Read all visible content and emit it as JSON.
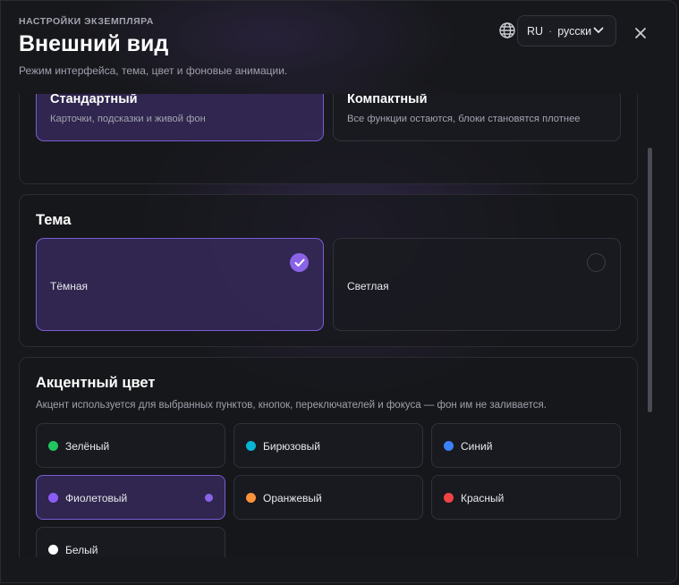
{
  "header": {
    "eyebrow": "НАСТРОЙКИ ЭКЗЕМПЛЯРА",
    "title": "Внешний вид",
    "subtitle": "Режим интерфейса, тема, цвет и фоновые анимации."
  },
  "language": {
    "code": "RU",
    "separator": "·",
    "name": "русски"
  },
  "mode": {
    "options": [
      {
        "title": "Стандартный",
        "description": "Карточки, подсказки и живой фон",
        "selected": true
      },
      {
        "title": "Компактный",
        "description": "Все функции остаются, блоки становятся плотнее",
        "selected": false
      }
    ]
  },
  "theme": {
    "title": "Тема",
    "options": [
      {
        "label": "Тёмная",
        "selected": true
      },
      {
        "label": "Светлая",
        "selected": false
      }
    ]
  },
  "accent": {
    "title": "Акцентный цвет",
    "description": "Акцент используется для выбранных пунктов, кнопок, переключателей и фокуса — фон им не заливается.",
    "colors": [
      {
        "label": "Зелёный",
        "color": "#22c55e",
        "selected": false
      },
      {
        "label": "Бирюзовый",
        "color": "#06b6d4",
        "selected": false
      },
      {
        "label": "Синий",
        "color": "#3b82f6",
        "selected": false
      },
      {
        "label": "Фиолетовый",
        "color": "#8b5cf6",
        "selected": true
      },
      {
        "label": "Оранжевый",
        "color": "#fb923c",
        "selected": false
      },
      {
        "label": "Красный",
        "color": "#ef4444",
        "selected": false
      },
      {
        "label": "Белый",
        "color": "#ffffff",
        "selected": false
      }
    ]
  },
  "icons": {
    "globe": "globe-icon",
    "chevron": "chevron-down-icon",
    "close": "close-icon",
    "check": "check-icon"
  }
}
